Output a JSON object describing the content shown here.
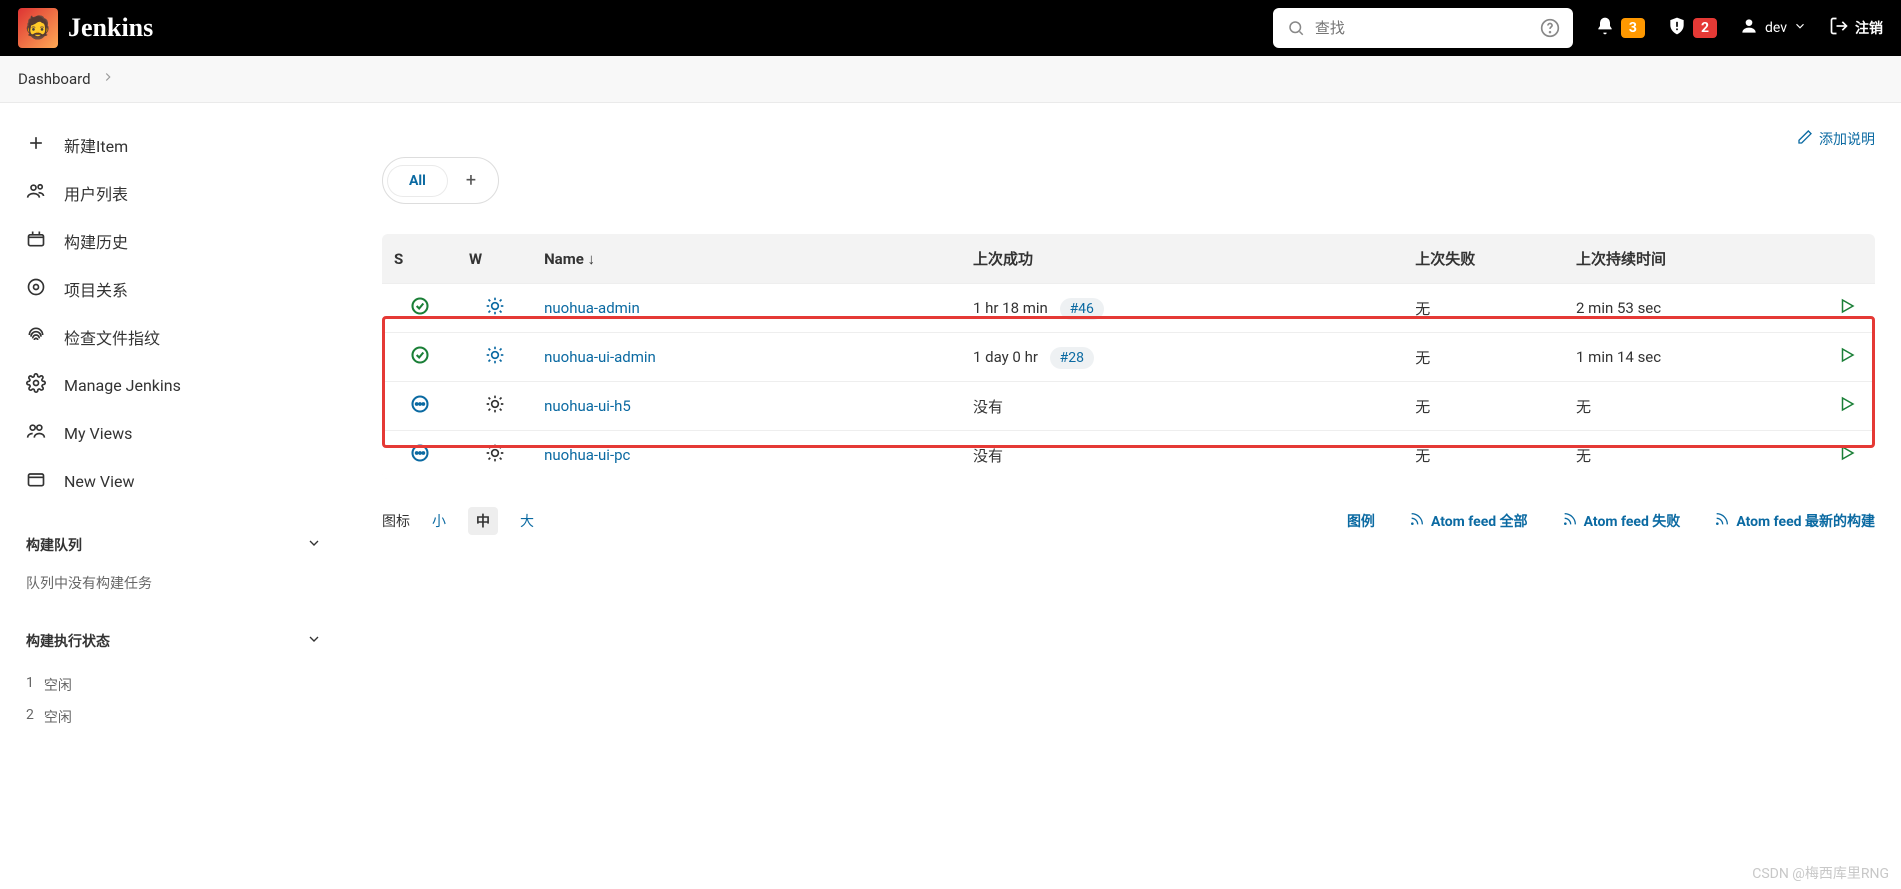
{
  "header": {
    "brand": "Jenkins",
    "search_placeholder": "查找",
    "notif_count": "3",
    "alert_count": "2",
    "user": "dev",
    "logout": "注销"
  },
  "breadcrumb": {
    "items": [
      "Dashboard"
    ]
  },
  "sidebar": {
    "links": [
      {
        "label": "新建Item",
        "icon": "plus"
      },
      {
        "label": "用户列表",
        "icon": "people"
      },
      {
        "label": "构建历史",
        "icon": "history"
      },
      {
        "label": "项目关系",
        "icon": "relation"
      },
      {
        "label": "检查文件指纹",
        "icon": "fingerprint"
      },
      {
        "label": "Manage Jenkins",
        "icon": "gear"
      },
      {
        "label": "My Views",
        "icon": "views"
      },
      {
        "label": "New View",
        "icon": "newview"
      }
    ],
    "queue": {
      "title": "构建队列",
      "empty": "队列中没有构建任务"
    },
    "exec": {
      "title": "构建执行状态",
      "rows": [
        {
          "n": "1",
          "s": "空闲"
        },
        {
          "n": "2",
          "s": "空闲"
        }
      ]
    }
  },
  "main": {
    "add_description": "添加说明",
    "tab_all": "All",
    "columns": {
      "s": "S",
      "w": "W",
      "name": "Name",
      "sort": "↓",
      "success": "上次成功",
      "fail": "上次失败",
      "duration": "上次持续时间"
    },
    "jobs": [
      {
        "status": "success",
        "weather": "sunny-blue",
        "name": "nuohua-admin",
        "success": "1 hr 18 min",
        "build": "#46",
        "fail": "无",
        "duration": "2 min 53 sec"
      },
      {
        "status": "success",
        "weather": "sunny-blue",
        "name": "nuohua-ui-admin",
        "success": "1 day 0 hr",
        "build": "#28",
        "fail": "无",
        "duration": "1 min 14 sec"
      },
      {
        "status": "notbuilt",
        "weather": "sunny-gray",
        "name": "nuohua-ui-h5",
        "success": "没有",
        "build": "",
        "fail": "无",
        "duration": "无"
      },
      {
        "status": "notbuilt",
        "weather": "sunny-gray",
        "name": "nuohua-ui-pc",
        "success": "没有",
        "build": "",
        "fail": "无",
        "duration": "无"
      }
    ],
    "footer": {
      "icon_label": "图标",
      "sizes": [
        "小",
        "中",
        "大"
      ],
      "legend": "图例",
      "feed_all": "Atom feed 全部",
      "feed_fail": "Atom feed 失败",
      "feed_latest": "Atom feed 最新的构建"
    }
  },
  "watermark": "CSDN @梅西库里RNG"
}
